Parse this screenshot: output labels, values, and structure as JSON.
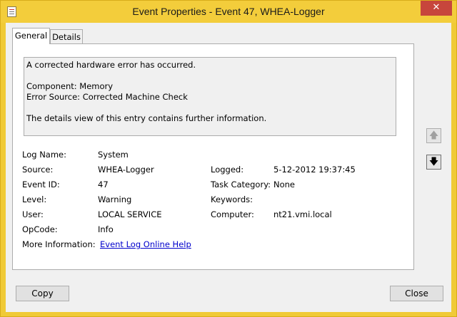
{
  "window": {
    "title": "Event Properties - Event 47, WHEA-Logger",
    "close_glyph": "✕"
  },
  "tabs": [
    {
      "label": "General",
      "active": true
    },
    {
      "label": "Details",
      "active": false
    }
  ],
  "description": {
    "lines": [
      "A corrected hardware error has occurred.",
      "",
      "Component: Memory",
      "Error Source: Corrected Machine Check",
      "",
      "The details view of this entry contains further information."
    ]
  },
  "fields": {
    "log_name": {
      "label": "Log Name:",
      "value": "System"
    },
    "source": {
      "label": "Source:",
      "value": "WHEA-Logger"
    },
    "event_id": {
      "label": "Event ID:",
      "value": "47"
    },
    "level": {
      "label": "Level:",
      "value": "Warning"
    },
    "user": {
      "label": "User:",
      "value": "LOCAL SERVICE"
    },
    "opcode": {
      "label": "OpCode:",
      "value": "Info"
    },
    "more_info": {
      "label": "More Information:",
      "value": "Event Log Online Help"
    },
    "logged": {
      "label": "Logged:",
      "value": "5-12-2012 19:37:45"
    },
    "task_category": {
      "label": "Task Category:",
      "value": "None"
    },
    "keywords": {
      "label": "Keywords:",
      "value": ""
    },
    "computer": {
      "label": "Computer:",
      "value": "nt21.vmi.local"
    }
  },
  "nav": {
    "up_icon": "arrow-up-icon",
    "down_icon": "arrow-down-icon",
    "up_glyph": "🡅",
    "down_glyph": "🡇"
  },
  "buttons": {
    "copy": "Copy",
    "close": "Close"
  },
  "colors": {
    "titlebar": "#f3cd3b",
    "close_button": "#c7463c",
    "link": "#0000cc"
  }
}
